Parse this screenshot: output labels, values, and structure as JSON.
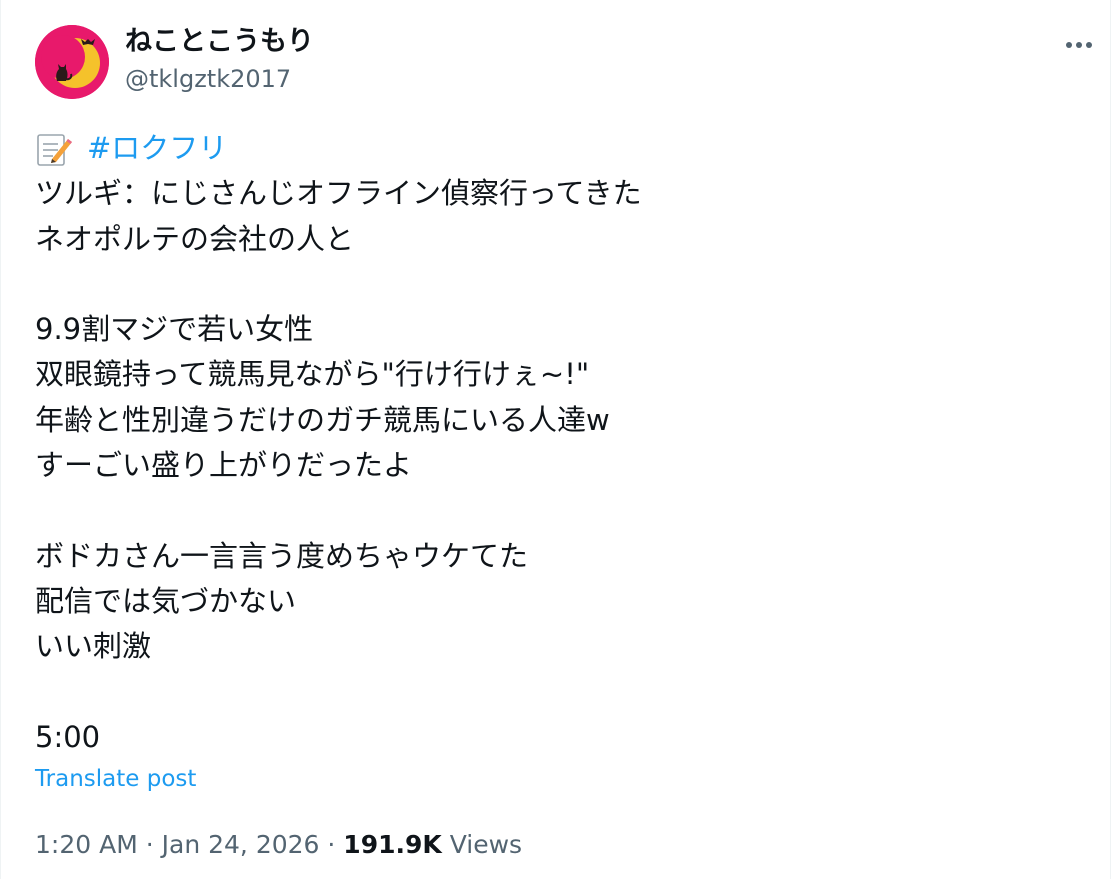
{
  "author": {
    "display_name": "ねことこうもり",
    "handle": "@tklgztk2017"
  },
  "post": {
    "memo_icon": "memo-icon",
    "hashtag": "#ロクフリ",
    "lines": [
      "ツルギ：にじさんじオフライン偵察行ってきた",
      "ネオポルテの会社の人と",
      "",
      "9.9割マジで若い女性",
      "双眼鏡持って競馬見ながら\"行け行けぇ~!\"",
      "年齢と性別違うだけのガチ競馬にいる人達w",
      "すーごい盛り上がりだったよ",
      "",
      "ボドカさん一言言う度めちゃウケてた",
      "配信では気づかない",
      "いい刺激",
      "",
      "5:00"
    ],
    "translate_label": "Translate post"
  },
  "meta": {
    "time": "1:20 AM",
    "separator": "·",
    "date": "Jan 24, 2026",
    "views_count": "191.9K",
    "views_label": "Views"
  },
  "colors": {
    "link": "#1d9bf0",
    "secondary_text": "#536471",
    "primary_text": "#0f1419",
    "avatar_bg": "#e8196b",
    "moon": "#f5c22b"
  },
  "icons": {
    "more": "more-horizontal-icon",
    "avatar": "moon-cat-bat-avatar"
  }
}
